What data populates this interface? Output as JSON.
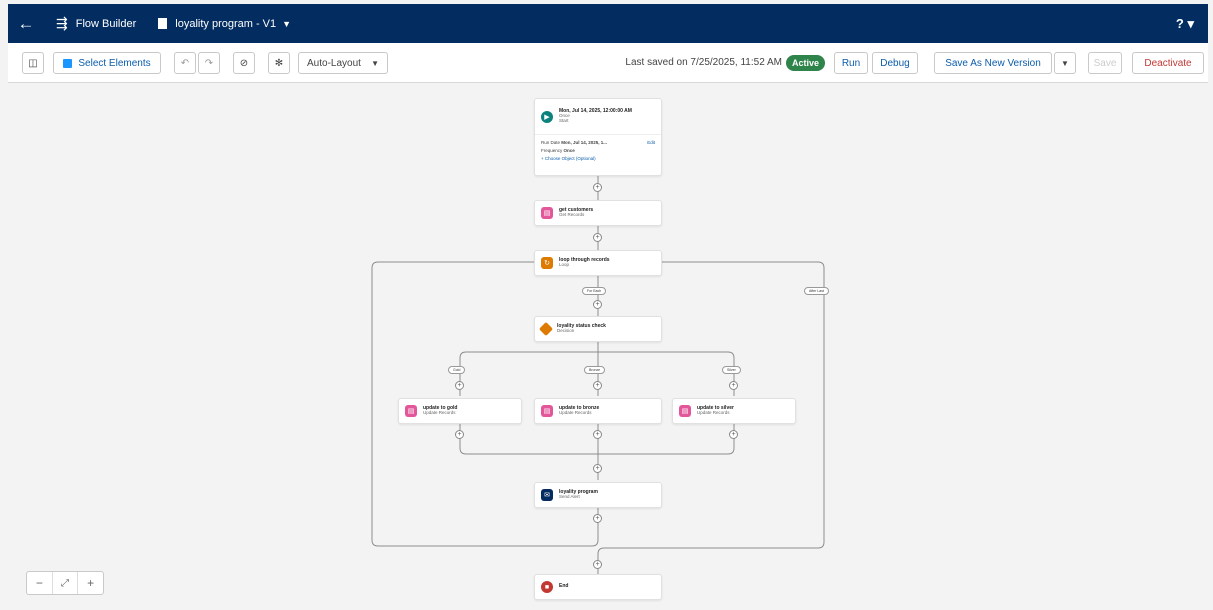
{
  "header": {
    "app_name": "Flow Builder",
    "flow_name": "loyality program - V1",
    "help_label": "?",
    "back_icon": "back-arrow-icon",
    "app_icon": "flow-builder-icon"
  },
  "toolbar": {
    "select_elements": "Select Elements",
    "layout": "Auto-Layout",
    "saved_text": "Last saved on 7/25/2025, 11:52 AM",
    "status": "Active",
    "run": "Run",
    "debug": "Debug",
    "save_new_version": "Save As New Version",
    "save": "Save",
    "deactivate": "Deactivate"
  },
  "canvas": {
    "start": {
      "title": "Mon, Jul 14, 2025, 12:00:00 AM",
      "line2": "Once",
      "line3": "Start",
      "run_date_label": "Run Date",
      "run_date_value": "Mon, Jul 14, 2025, 1...",
      "edit": "Edit",
      "frequency_label": "Frequency",
      "frequency_value": "Once",
      "choose_object": "+ Choose Object (Optional)"
    },
    "nodes": [
      {
        "key": "get",
        "title": "get customers",
        "sub": "Get Records",
        "color": "#e3569a"
      },
      {
        "key": "loop",
        "title": "loop through records",
        "sub": "Loop",
        "color": "#dd7a01"
      },
      {
        "key": "decision",
        "title": "loyality status check",
        "sub": "Decision",
        "color": "#dd7a01"
      },
      {
        "key": "gold",
        "title": "update to gold",
        "sub": "Update Records",
        "color": "#e3569a"
      },
      {
        "key": "bronze",
        "title": "update to bronze",
        "sub": "Update Records",
        "color": "#e3569a"
      },
      {
        "key": "silver",
        "title": "update to silver",
        "sub": "Update Records",
        "color": "#e3569a"
      },
      {
        "key": "email",
        "title": "loyality program",
        "sub": "Send Alert",
        "color": "#032d60"
      },
      {
        "key": "end",
        "title": "End",
        "sub": "",
        "color": "#c23934"
      }
    ],
    "labels": {
      "for_each": "For Each",
      "after_last": "After Last",
      "gold": "Gold",
      "bronze": "Bronze",
      "silver": "Silver"
    }
  },
  "colors": {
    "header_bg": "#032d60",
    "brand_blue": "#0b5cab",
    "active_green": "#2e844a",
    "deactivate_red": "#c23934",
    "canvas_bg": "#f3f3f3"
  }
}
